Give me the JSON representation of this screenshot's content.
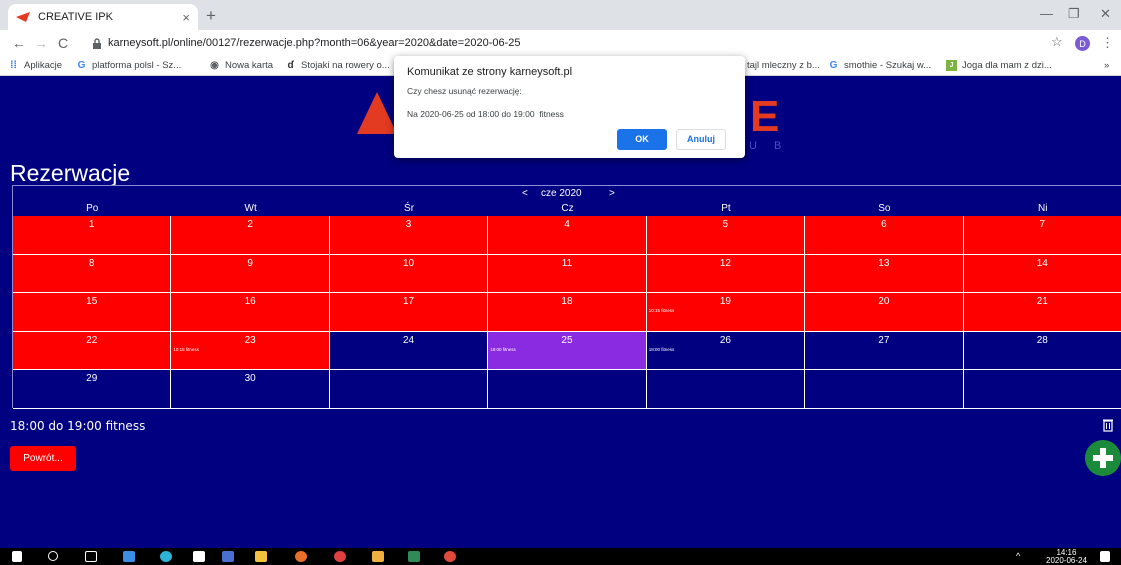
{
  "browser": {
    "tab_title": "CREATIVE IPK",
    "tab_close": "×",
    "new_tab": "+",
    "url": "karneysoft.pl/online/00127/rezerwacje.php?month=06&year=2020&date=2020-06-25",
    "bookmarks": [
      {
        "label": "Aplikacje"
      },
      {
        "label": "platforma polsl - Sz..."
      },
      {
        "label": "Nowa karta"
      },
      {
        "label": "Stojaki na rowery o..."
      },
      {
        "label": "tajl mleczny z b..."
      },
      {
        "label": "smothie - Szukaj w..."
      },
      {
        "label": "Joga dla mam z dzi..."
      }
    ],
    "bookmarks_more": "»",
    "profile_initial": "D"
  },
  "page": {
    "logo_letter": "E",
    "logo_suffix": "U B",
    "title": "Rezerwacje",
    "month_prev": "<",
    "month_label": "cze 2020",
    "month_next": ">",
    "weekdays": [
      "Po",
      "Wt",
      "Śr",
      "Cz",
      "Pt",
      "So",
      "Ni"
    ],
    "selected_info": "18:00 do 19:00   fitness",
    "back_button": "Powrót..."
  },
  "calendar": {
    "weeks": [
      [
        {
          "d": "1",
          "s": "red",
          "e": ""
        },
        {
          "d": "2",
          "s": "red",
          "e": ""
        },
        {
          "d": "3",
          "s": "red",
          "e": ""
        },
        {
          "d": "4",
          "s": "red",
          "e": ""
        },
        {
          "d": "5",
          "s": "red",
          "e": ""
        },
        {
          "d": "6",
          "s": "red",
          "e": ""
        },
        {
          "d": "7",
          "s": "red",
          "e": ""
        }
      ],
      [
        {
          "d": "8",
          "s": "red",
          "e": ""
        },
        {
          "d": "9",
          "s": "red",
          "e": ""
        },
        {
          "d": "10",
          "s": "red",
          "e": ""
        },
        {
          "d": "11",
          "s": "red",
          "e": ""
        },
        {
          "d": "12",
          "s": "red",
          "e": ""
        },
        {
          "d": "13",
          "s": "red",
          "e": ""
        },
        {
          "d": "14",
          "s": "red",
          "e": ""
        }
      ],
      [
        {
          "d": "15",
          "s": "red",
          "e": ""
        },
        {
          "d": "16",
          "s": "red",
          "e": ""
        },
        {
          "d": "17",
          "s": "red",
          "e": ""
        },
        {
          "d": "18",
          "s": "red",
          "e": ""
        },
        {
          "d": "19",
          "s": "red",
          "e": "10:15 fitness"
        },
        {
          "d": "20",
          "s": "red",
          "e": ""
        },
        {
          "d": "21",
          "s": "red",
          "e": ""
        }
      ],
      [
        {
          "d": "22",
          "s": "red",
          "e": ""
        },
        {
          "d": "23",
          "s": "red",
          "e": "10:15 fitness"
        },
        {
          "d": "24",
          "s": "blue",
          "e": ""
        },
        {
          "d": "25",
          "s": "purple",
          "e": "18:00 fitness"
        },
        {
          "d": "26",
          "s": "blue",
          "e": "18:00 fitness"
        },
        {
          "d": "27",
          "s": "blue",
          "e": ""
        },
        {
          "d": "28",
          "s": "blue",
          "e": ""
        }
      ],
      [
        {
          "d": "29",
          "s": "blue",
          "e": ""
        },
        {
          "d": "30",
          "s": "blue",
          "e": ""
        },
        {
          "d": "",
          "s": "blue",
          "e": ""
        },
        {
          "d": "",
          "s": "blue",
          "e": ""
        },
        {
          "d": "",
          "s": "blue",
          "e": ""
        },
        {
          "d": "",
          "s": "blue",
          "e": ""
        },
        {
          "d": "",
          "s": "blue",
          "e": ""
        }
      ]
    ]
  },
  "dialog": {
    "title": "Komunikat ze strony karneysoft.pl",
    "question": "Czy chesz usunąć rezerwację:",
    "message": "Na 2020-06-25 od 18:00 do 19:00  fitness",
    "ok": "OK",
    "cancel": "Anuluj"
  },
  "taskbar": {
    "time": "14:16",
    "date": "2020-06-24"
  },
  "colors": {
    "page_bg": "#000080",
    "free_day": "#ff0000",
    "selected_day": "#8a2be2",
    "accent": "#1a73e8"
  }
}
